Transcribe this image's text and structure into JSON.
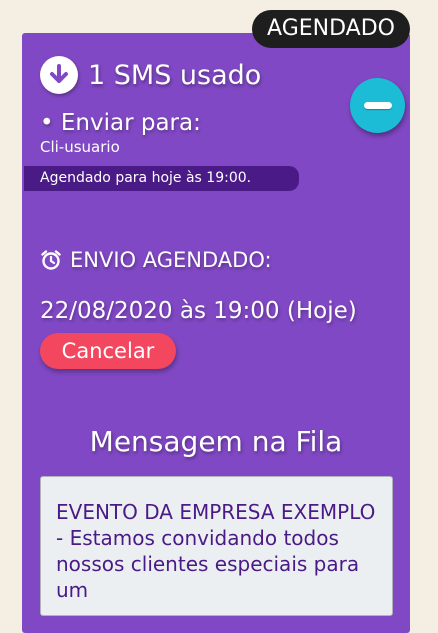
{
  "status_badge": "AGENDADO",
  "sms_usage": {
    "icon": "arrow-down-circle-icon",
    "text": "1 SMS usado"
  },
  "collapse_button": {
    "icon": "minus-icon",
    "color": "#1cbcd6"
  },
  "send_to": {
    "label": "• Enviar para:",
    "recipient": "Cli-usuario",
    "scheduled_note": "Agendado para hoje às 19:00."
  },
  "schedule": {
    "icon": "alarm-clock-icon",
    "title": "ENVIO AGENDADO:",
    "datetime": "22/08/2020 às 19:00 (Hoje)",
    "cancel_label": "Cancelar"
  },
  "queue": {
    "title": "Mensagem na Fila",
    "message": "EVENTO DA EMPRESA EXEMPLO - Estamos convidando todos nossos clientes especiais para um"
  },
  "colors": {
    "page_background": "#f5efe3",
    "card_background": "#8048c4",
    "badge_background": "#1e1e1e",
    "cancel_button": "#f2475f",
    "scheduled_pill": "#4a1a86"
  }
}
